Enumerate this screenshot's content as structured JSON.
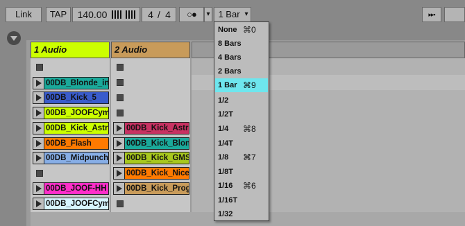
{
  "toolbar": {
    "link": "Link",
    "tap": "TAP",
    "tempo": "140.00",
    "sig_num": "4",
    "sig_slash": "/",
    "sig_den": "4",
    "metro_glyph": "○●",
    "quantize_value": "1 Bar",
    "quantize_arrow": "▾",
    "small_arrow": "▾",
    "right_glyph": "▸▸▪"
  },
  "tracks": [
    {
      "name": "1 Audio",
      "color": "#ccff00"
    },
    {
      "name": "2 Audio",
      "color": "#c89b5a"
    }
  ],
  "clips_track1": [
    {
      "name": "00DB_Blonde_in",
      "color": "#1aa99a"
    },
    {
      "name": "00DB_Kick_5",
      "color": "#3a5ccc"
    },
    {
      "name": "00DB_JOOFCym",
      "color": "#ccff00"
    },
    {
      "name": "00DB_Kick_Astr",
      "color": "#ccff00"
    },
    {
      "name": "00DB_Flash",
      "color": "#ff7a00"
    },
    {
      "name": "00DB_Midpunch",
      "color": "#87aee6"
    },
    {
      "name": "00DB_JOOF-HH",
      "color": "#ff2ec8"
    },
    {
      "name": "00DB_JOOFCym",
      "color": "#d7f5ff"
    }
  ],
  "clips_track2": [
    {
      "name": "00DB_Kick_Astr",
      "color": "#c83262"
    },
    {
      "name": "00DB_Kick_Blon",
      "color": "#1aa99a"
    },
    {
      "name": "00DB_Kick_GMS",
      "color": "#a8c81e"
    },
    {
      "name": "00DB_Kick_Nice",
      "color": "#ff7a00"
    },
    {
      "name": "00DB_Kick_Prog",
      "color": "#c89b5a"
    }
  ],
  "quantize_menu": {
    "selected": "1 Bar",
    "items": [
      {
        "label": "None",
        "shortcut": "⌘0"
      },
      {
        "label": "8 Bars",
        "shortcut": ""
      },
      {
        "label": "4 Bars",
        "shortcut": ""
      },
      {
        "label": "2 Bars",
        "shortcut": ""
      },
      {
        "label": "1 Bar",
        "shortcut": "⌘9"
      },
      {
        "label": "1/2",
        "shortcut": ""
      },
      {
        "label": "1/2T",
        "shortcut": ""
      },
      {
        "label": "1/4",
        "shortcut": "⌘8"
      },
      {
        "label": "1/4T",
        "shortcut": ""
      },
      {
        "label": "1/8",
        "shortcut": "⌘7"
      },
      {
        "label": "1/8T",
        "shortcut": ""
      },
      {
        "label": "1/16",
        "shortcut": "⌘6"
      },
      {
        "label": "1/16T",
        "shortcut": ""
      },
      {
        "label": "1/32",
        "shortcut": ""
      }
    ]
  }
}
